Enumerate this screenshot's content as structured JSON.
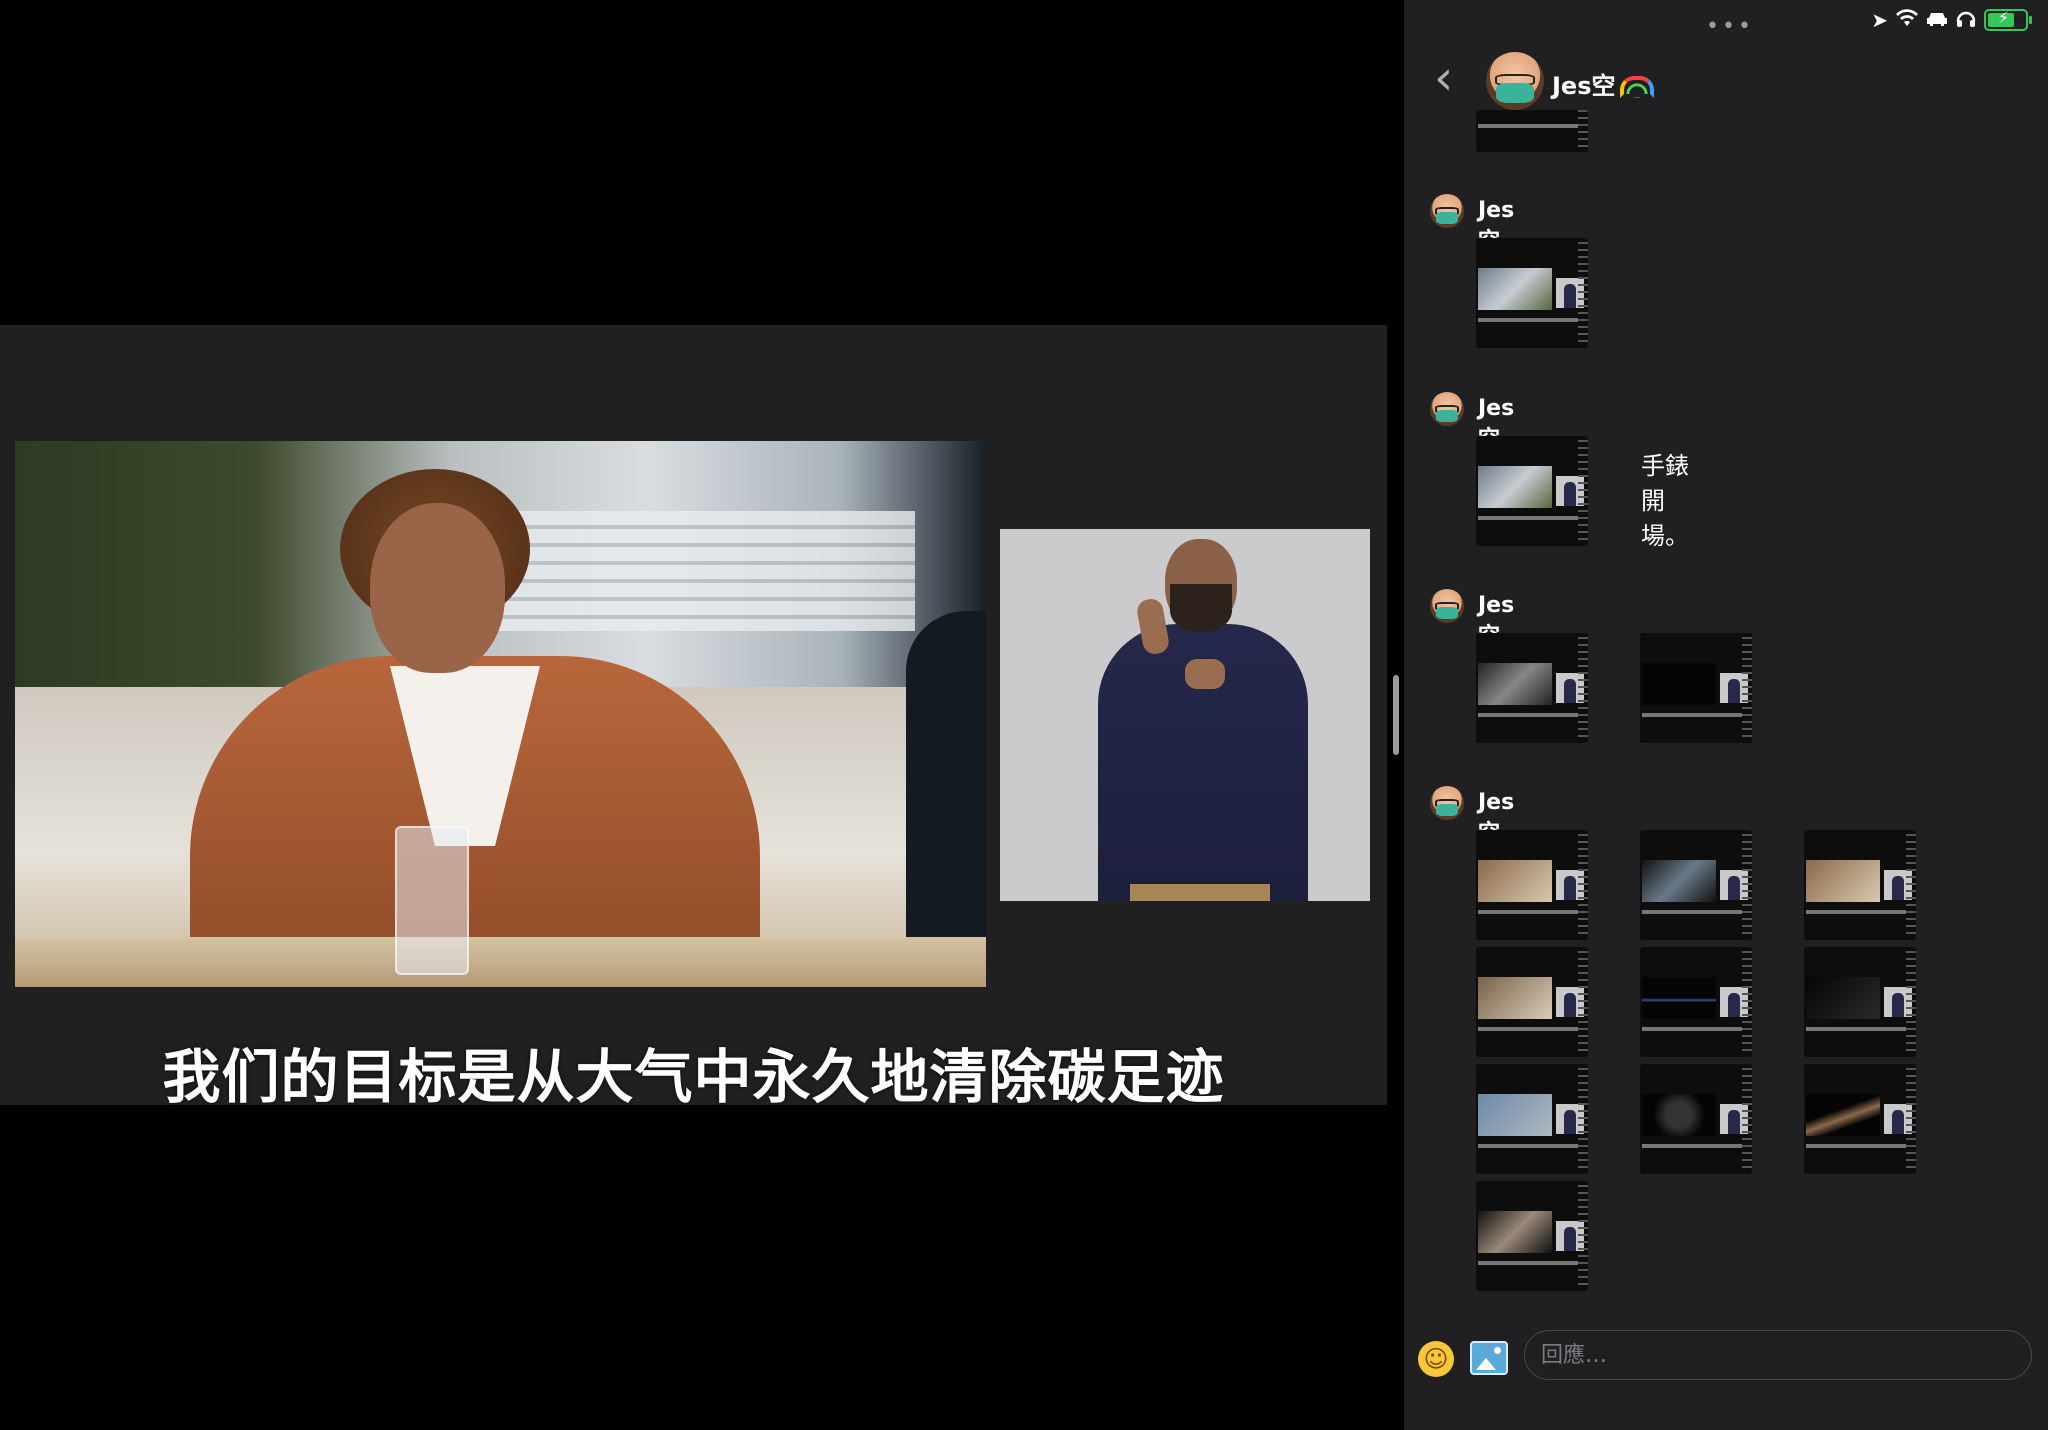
{
  "video": {
    "subtitle": "我们的目标是从大气中永久地清除碳足迹"
  },
  "status_bar": {
    "multitask_dots": "•••",
    "icons": [
      "location-arrow-icon",
      "wifi-icon",
      "car-icon",
      "headphones-icon",
      "battery-charging-icon"
    ],
    "battery_color": "#34c759"
  },
  "chat": {
    "header_name": "Jes空",
    "sender_name": "Jes空",
    "message_text": "手錶開場。",
    "composer_placeholder": "回應…"
  },
  "colors": {
    "chat_bg": "#202022",
    "video_frame_bg": "#202020",
    "page_bg": "#000000"
  }
}
